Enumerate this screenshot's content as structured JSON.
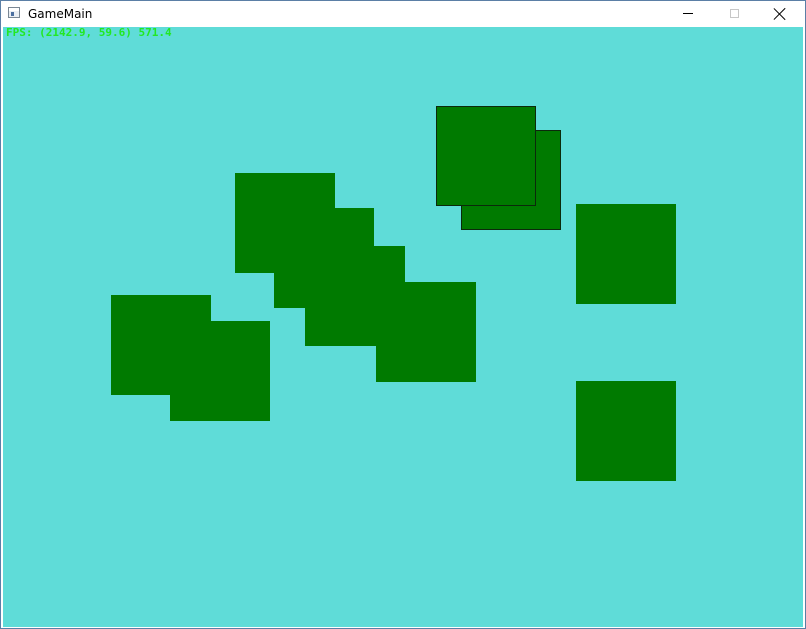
{
  "window": {
    "title": "GameMain",
    "icon": "application-window-icon",
    "controls": {
      "minimize": "minimize-icon",
      "maximize": "maximize-icon",
      "close": "close-icon"
    }
  },
  "game": {
    "background_color": "#5fdcd8",
    "square_color": "#007a00",
    "fps_color": "#22e822",
    "fps_text": "FPS: (2142.9, 59.6) 571.4",
    "square_count": 10
  }
}
